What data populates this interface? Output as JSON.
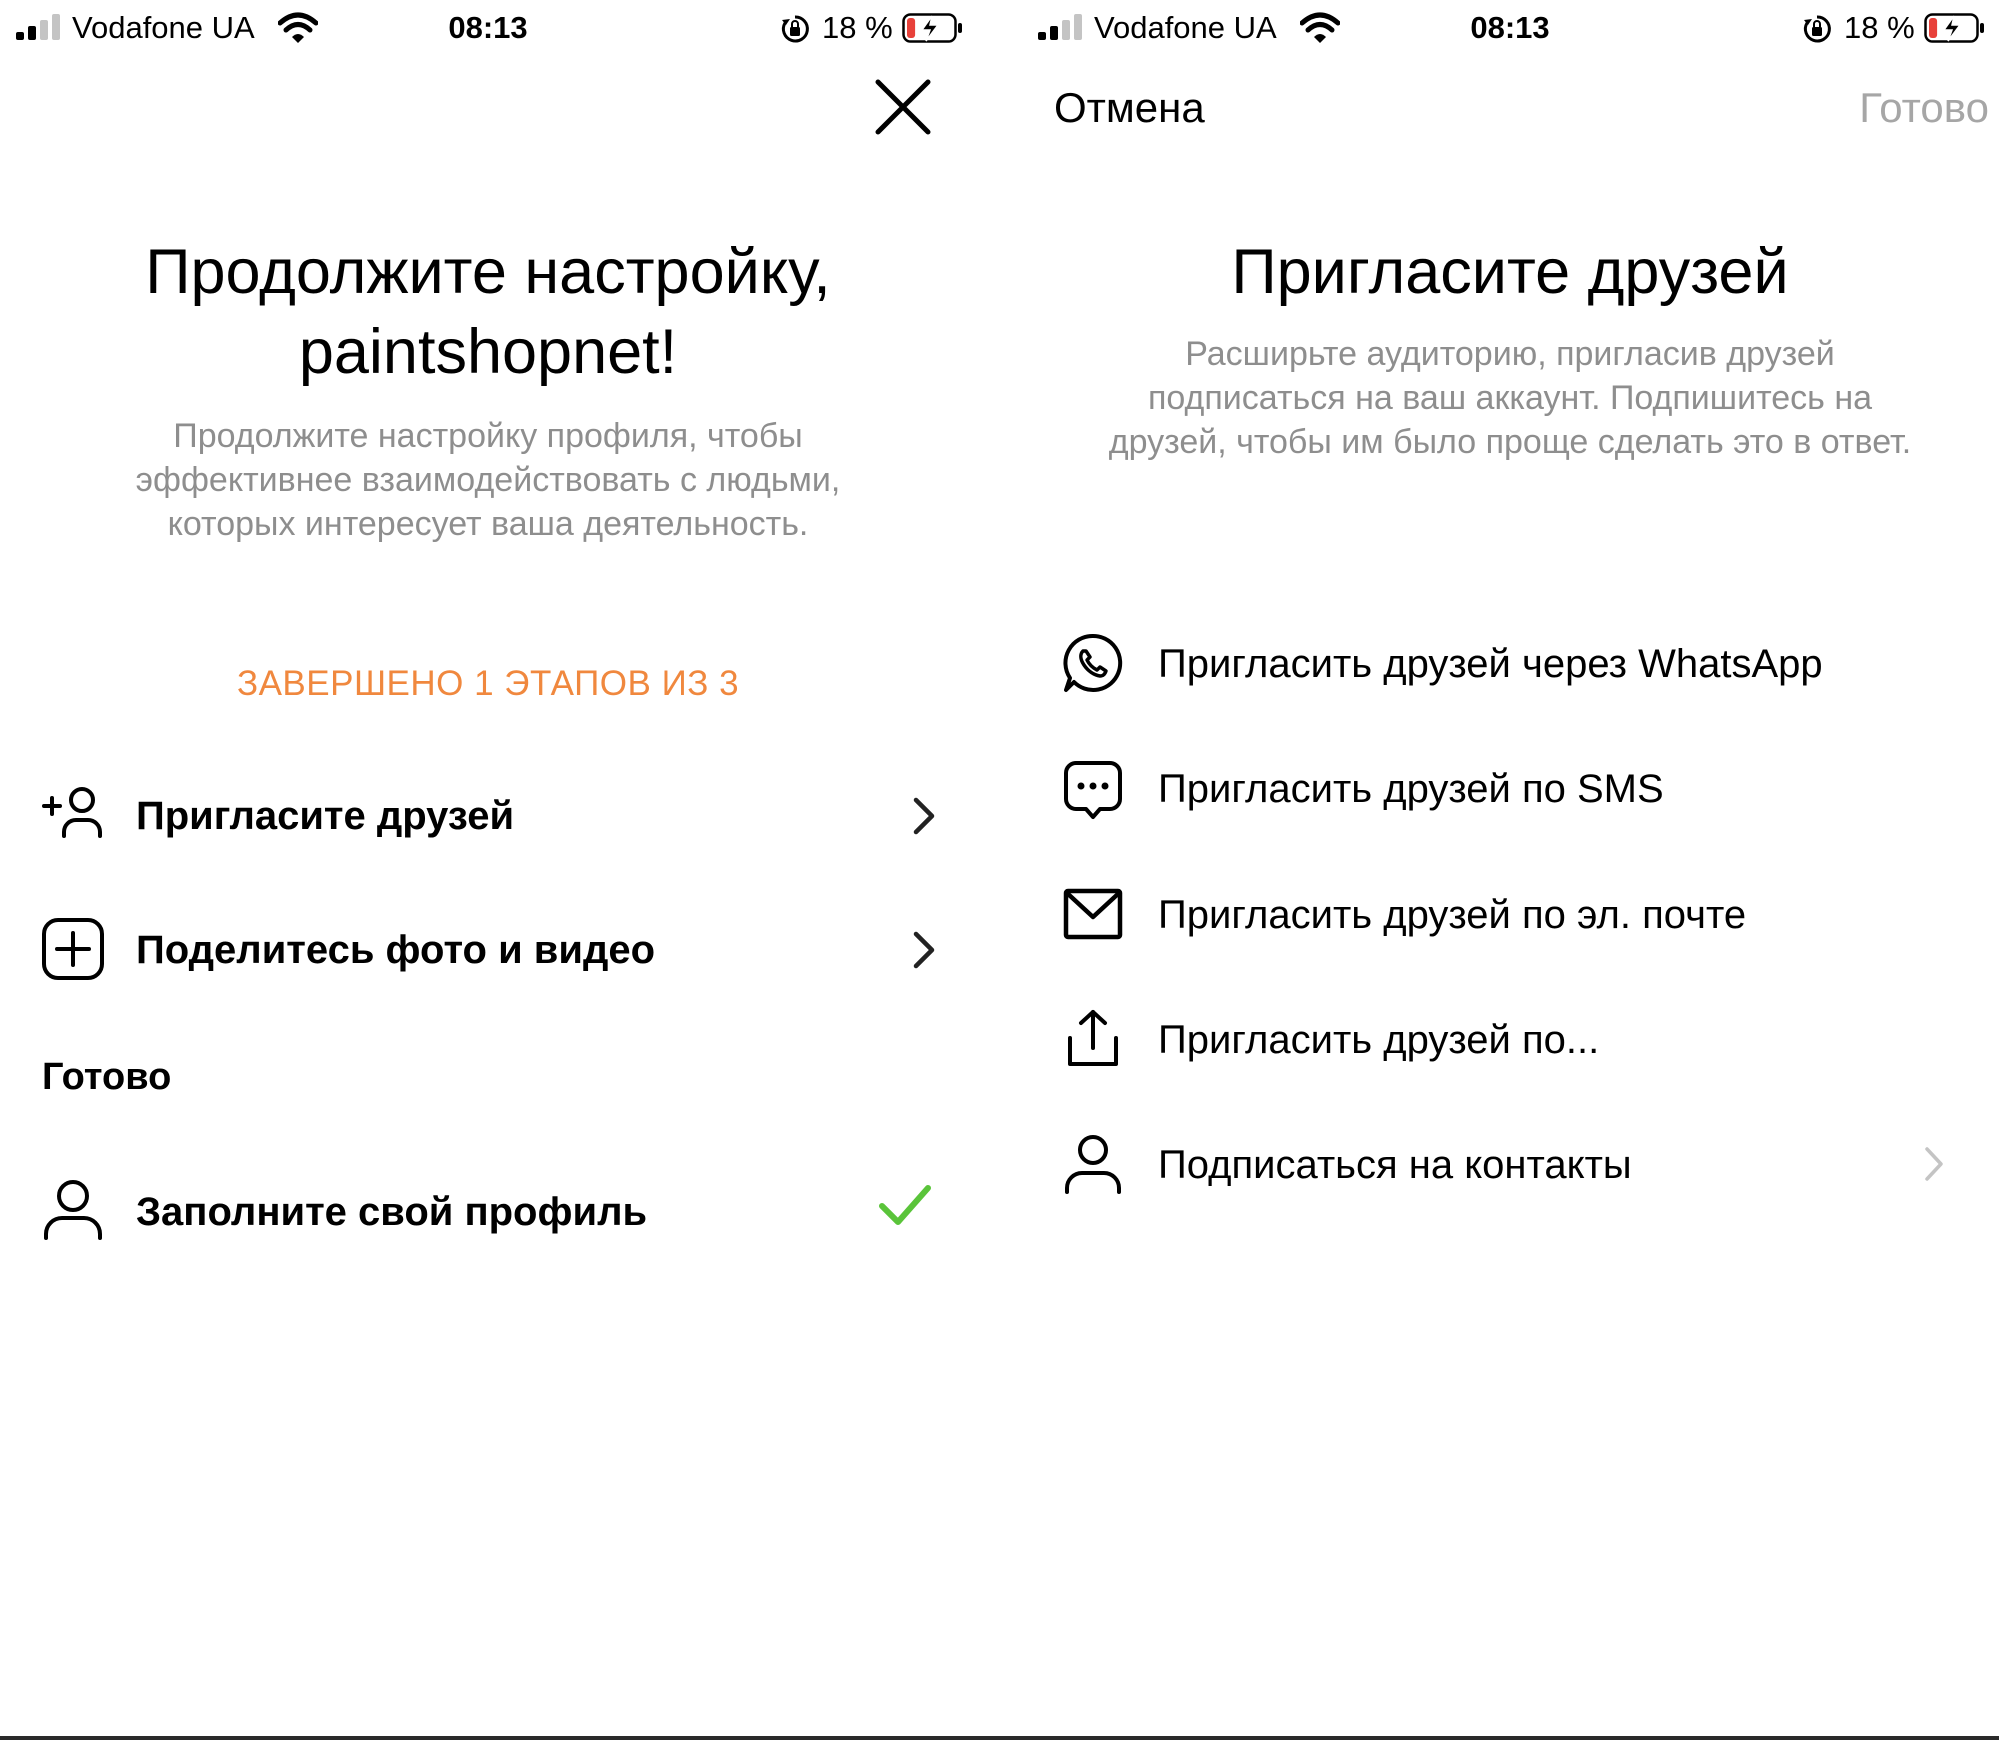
{
  "status_bar": {
    "carrier": "Vodafone UA",
    "time": "08:13",
    "battery_percent": "18 %",
    "battery_level": 0.18,
    "signal_bars_on": 2,
    "signal_bars_total": 4
  },
  "left_screen": {
    "title_line1": "Продолжите настройку,",
    "title_line2": "paintshopnet!",
    "subtitle": "Продолжите настройку профиля, чтобы эффективнее взаимодействовать с людьми, которых интересует ваша деятельность.",
    "progress": "ЗАВЕРШЕНО 1 ЭТАПОВ ИЗ 3",
    "progress_completed": 1,
    "progress_total": 3,
    "steps": [
      {
        "label": "Пригласите друзей",
        "icon": "add-person-icon"
      },
      {
        "label": "Поделитесь фото и видео",
        "icon": "add-post-icon"
      }
    ],
    "done_section": "Готово",
    "done_steps": [
      {
        "label": "Заполните свой профиль",
        "icon": "person-icon",
        "status": "completed"
      }
    ]
  },
  "right_screen": {
    "cancel": "Отмена",
    "done": "Готово",
    "title": "Пригласите друзей",
    "subtitle": "Расширьте аудиторию, пригласив друзей подписаться на ваш аккаунт. Подпишитесь на друзей, чтобы им было проще сделать это в ответ.",
    "options": [
      {
        "label": "Пригласить друзей через WhatsApp",
        "icon": "whatsapp-icon"
      },
      {
        "label": "Пригласить друзей по SMS",
        "icon": "sms-icon"
      },
      {
        "label": "Пригласить друзей по эл. почте",
        "icon": "mail-icon"
      },
      {
        "label": "Пригласить друзей по...",
        "icon": "share-icon"
      },
      {
        "label": "Подписаться на контакты",
        "icon": "person-icon"
      }
    ]
  },
  "colors": {
    "progress_orange": "#f0883e",
    "check_green": "#5ac43a",
    "secondary_text": "#8e8e8e",
    "disabled_text": "#a6a6a6",
    "battery_low_red": "#e8413a"
  }
}
